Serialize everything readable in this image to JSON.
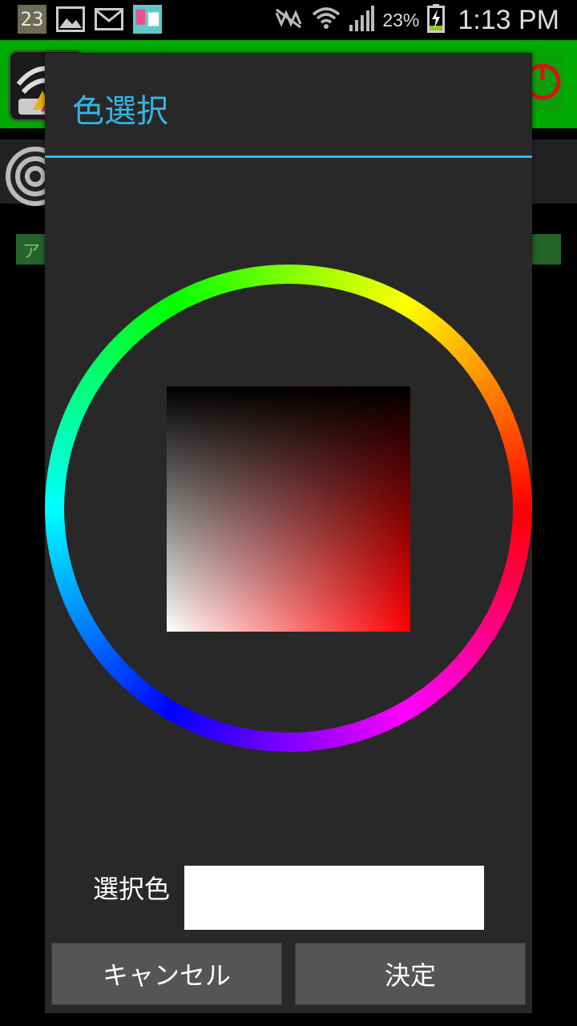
{
  "status_bar": {
    "calendar_day": "23",
    "battery_percent": "23%",
    "time": "1:13 PM",
    "icons": [
      "calendar-icon",
      "gallery-icon",
      "gmail-icon",
      "app-notification-icon",
      "mute-icon",
      "wifi-icon",
      "signal-icon",
      "battery-charging-icon"
    ]
  },
  "background_app": {
    "banner_text": "ア"
  },
  "dialog": {
    "title": "色選択",
    "selected_label": "選択色",
    "selected_color": "#ffffff",
    "hue_color": "#ff0000",
    "cancel_label": "キャンセル",
    "ok_label": "決定",
    "accent_color": "#33b5e5"
  }
}
